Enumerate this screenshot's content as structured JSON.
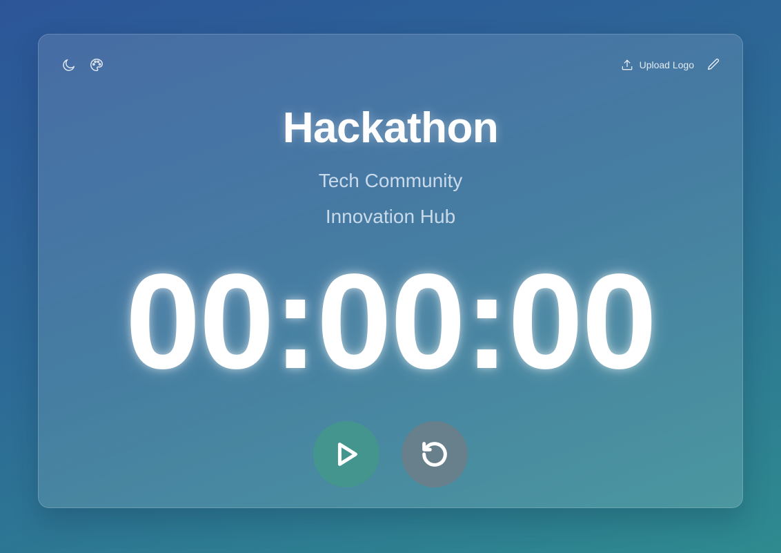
{
  "toolbar": {
    "left_icons": [
      "moon-icon",
      "palette-icon"
    ],
    "upload_label": "Upload Logo",
    "upload_icon": "upload-icon",
    "edit_icon": "pencil-icon"
  },
  "event": {
    "title": "Hackathon",
    "subtitle_1": "Tech Community",
    "subtitle_2": "Innovation Hub"
  },
  "timer": {
    "display": "00:00:00"
  },
  "controls": {
    "play_icon": "play-icon",
    "reset_icon": "reset-icon"
  },
  "colors": {
    "play_button": "#44958e",
    "reset_button": "#687f8c",
    "text": "#ffffff"
  }
}
